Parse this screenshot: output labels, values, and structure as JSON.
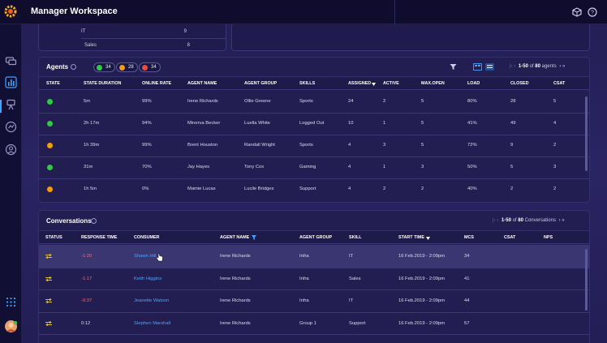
{
  "app": {
    "title": "Manager Workspace"
  },
  "mini": {
    "rows": [
      {
        "label": "IT",
        "value": "9"
      },
      {
        "label": "Sales",
        "value": "8"
      }
    ]
  },
  "agents": {
    "title": "Agents",
    "pills": [
      {
        "count": "34",
        "color": "#2ecc40"
      },
      {
        "count": "28",
        "color": "#f39c12"
      },
      {
        "count": "34",
        "color": "#e74c3c"
      }
    ],
    "pager": {
      "prefix": "1-50",
      "mid": " of ",
      "total": "80",
      "suffix": " agents"
    },
    "columns": [
      "STATE",
      "STATE DURATION",
      "ONLINE RATE",
      "AGENT NAME",
      "AGENT GROUP",
      "SKILLS",
      "ASSIGNED",
      "ACTIVE",
      "MAX.OPEN",
      "LOAD",
      "CLOSED",
      "CSAT"
    ],
    "rows": [
      {
        "state": "#2ecc40",
        "duration": "5m",
        "rate": "99%",
        "name": "Irene Richards",
        "group": "Ollie Greene",
        "skills": "Sports",
        "assigned": "24",
        "active": "2",
        "maxopen": "5",
        "load": "80%",
        "closed": "28",
        "csat": "5"
      },
      {
        "state": "#2ecc40",
        "duration": "2h 17m",
        "rate": "94%",
        "name": "Minerva Becker",
        "group": "Luella White",
        "skills": "Logged Out",
        "assigned": "10",
        "active": "1",
        "maxopen": "5",
        "load": "41%",
        "closed": "49",
        "csat": "4"
      },
      {
        "state": "#f39c12",
        "duration": "1h 39m",
        "rate": "99%",
        "name": "Brent Houston",
        "group": "Randall Wright",
        "skills": "Sports",
        "assigned": "4",
        "active": "3",
        "maxopen": "5",
        "load": "72%",
        "closed": "9",
        "csat": "2"
      },
      {
        "state": "#2ecc40",
        "duration": "31m",
        "rate": "70%",
        "name": "Jay Hayes",
        "group": "Tony Cox",
        "skills": "Gaming",
        "assigned": "4",
        "active": "1",
        "maxopen": "3",
        "load": "50%",
        "closed": "5",
        "csat": "3"
      },
      {
        "state": "#f39c12",
        "duration": "1h 5m",
        "rate": "0%",
        "name": "Mamie Lucas",
        "group": "Lucile Bridges",
        "skills": "Support",
        "assigned": "4",
        "active": "2",
        "maxopen": "2",
        "load": "40%",
        "closed": "2",
        "csat": "2"
      }
    ]
  },
  "conversations": {
    "title": "Conversations",
    "pager": {
      "prefix": "1-50",
      "mid": " of ",
      "total": "80",
      "suffix": " Conversations"
    },
    "columns": [
      "STATUS",
      "RESPONSE TIME",
      "CONSUMER",
      "AGENT NAME",
      "AGENT GROUP",
      "SKILL",
      "START TIME",
      "MCS",
      "CSAT",
      "NPS"
    ],
    "rows": [
      {
        "response": "-1:20",
        "neg": true,
        "consumer": "Shawn Hill",
        "agent": "Irene Richards",
        "group": "Infra",
        "skill": "IT",
        "start": "16 Feb.2019 - 2:09pm",
        "mcs": "34"
      },
      {
        "response": "-1:17",
        "neg": true,
        "consumer": "Keith Higgins",
        "agent": "Irene Richards",
        "group": "Infra",
        "skill": "Sales",
        "start": "16 Feb.2019 - 2:09pm",
        "mcs": "41"
      },
      {
        "response": "-0:37",
        "neg": true,
        "consumer": "Jeanette Watson",
        "agent": "Irene Richards",
        "group": "Infra",
        "skill": "IT",
        "start": "16 Feb.2019 - 2:09pm",
        "mcs": "44"
      },
      {
        "response": "0:12",
        "neg": false,
        "consumer": "Stephen Marshall",
        "agent": "Irene Richards",
        "group": "Group 1",
        "skill": "Support",
        "start": "16 Feb.2019 - 2:09pm",
        "mcs": "57"
      }
    ]
  },
  "colors": {
    "accent": "#3da5ff",
    "link": "#49a6ff",
    "negative": "#ff6a6a",
    "status_icon": "#e0c020"
  },
  "icons": [
    "app-logo-icon",
    "cube-icon",
    "help-icon",
    "chat-icon",
    "bar-chart-icon",
    "user-badge-icon",
    "routing-icon",
    "agent-circle-icon",
    "apps-grid-icon",
    "avatar",
    "filter-icon",
    "grid-view-icon",
    "list-view-icon",
    "sort-down-icon",
    "transfer-icon",
    "cursor-hand-icon"
  ]
}
